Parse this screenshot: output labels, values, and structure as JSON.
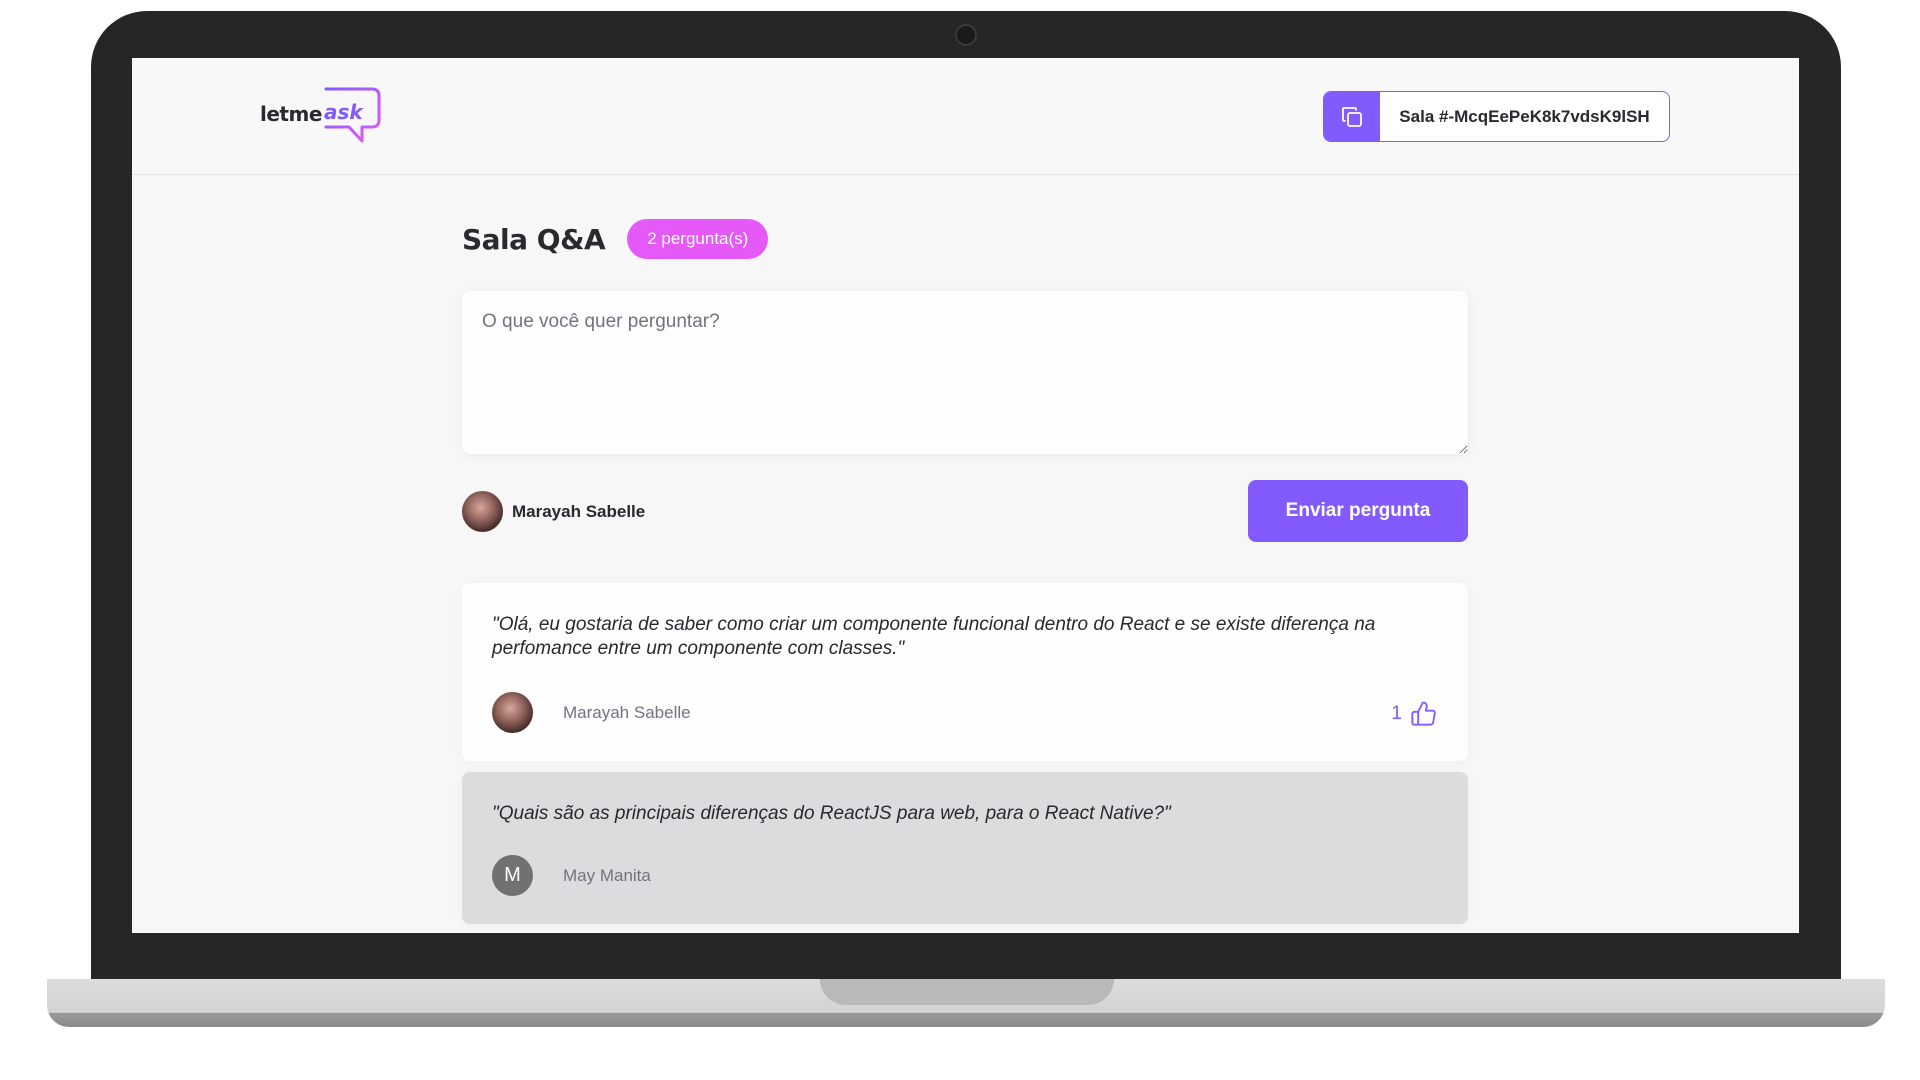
{
  "logo": {
    "text_main": "letme",
    "text_accent": "ask"
  },
  "header": {
    "room_code": "Sala #-McqEePeK8k7vdsK9lSH"
  },
  "room": {
    "title": "Sala Q&A",
    "question_count": "2 pergunta(s)"
  },
  "form": {
    "placeholder": "O que você quer perguntar?",
    "user_name": "Marayah Sabelle",
    "submit_label": "Enviar pergunta"
  },
  "questions": [
    {
      "content": "\"Olá, eu gostaria de saber como criar um componente funcional dentro do React e se existe diferença na perfomance entre um componente com classes.\"",
      "author": "Marayah Sabelle",
      "like_count": "1",
      "highlighted": false
    },
    {
      "content": "\"Quais são as principais diferenças do ReactJS para web, para o React Native?\"",
      "author": "May Manita",
      "avatar_letter": "M",
      "highlighted": true
    }
  ],
  "colors": {
    "accent": "#835afd",
    "badge": "#e559f9",
    "highlight_bg": "#dbdcdd"
  },
  "icons": {
    "copy": "copy-icon",
    "like": "thumbs-up-icon",
    "logo": "speech-bubble-icon"
  }
}
